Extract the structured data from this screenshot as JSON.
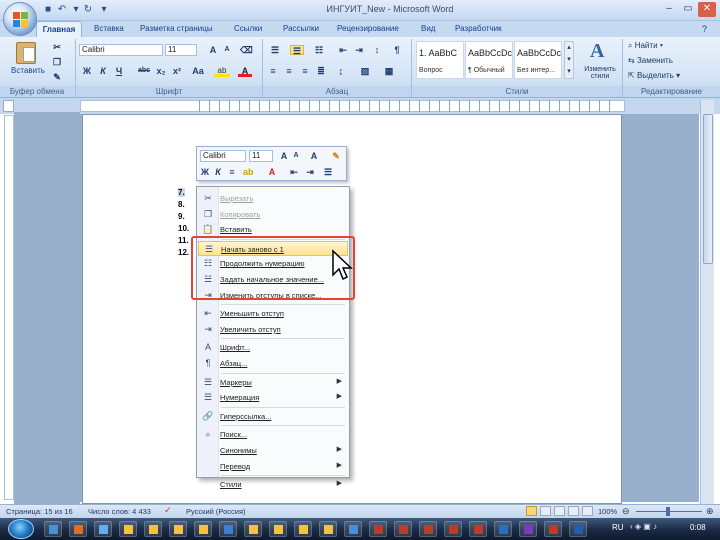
{
  "window": {
    "title": "ИНГУИТ_New - Microsoft Word"
  },
  "tabs": [
    "Главная",
    "Вставка",
    "Разметка страницы",
    "Ссылки",
    "Рассылки",
    "Рецензирование",
    "Вид",
    "Разработчик"
  ],
  "ribbon": {
    "clipboard": {
      "paste_label": "Вставить",
      "group_label": "Буфер обмена"
    },
    "font": {
      "name": "Calibri",
      "size": "11",
      "group_label": "Шрифт",
      "buttons": [
        "Ж",
        "К",
        "Ч",
        "abc",
        "x₂",
        "x²",
        "Aa"
      ]
    },
    "paragraph": {
      "group_label": "Абзац"
    },
    "styles": {
      "group_label": "Стили",
      "items": [
        {
          "preview": "1. AaBbC",
          "name": "Вопрос"
        },
        {
          "preview": "AaBbCcDc",
          "name": "¶ Обычный"
        },
        {
          "preview": "AaBbCcDc",
          "name": "Без интер..."
        }
      ],
      "change_styles": "Изменить стили"
    },
    "editing": {
      "group_label": "Редактирование",
      "find": "Найти",
      "replace": "Заменить",
      "select": "Выделить"
    }
  },
  "mini_toolbar": {
    "font": "Calibri",
    "size": "11"
  },
  "numbered_list": [
    "7.",
    "8.",
    "9.",
    "10.",
    "11.",
    "12."
  ],
  "context_menu": [
    {
      "label": "Вырезать",
      "icon": "scissors-icon",
      "disabled": true
    },
    {
      "label": "Копировать",
      "icon": "copy-icon",
      "disabled": true
    },
    {
      "label": "Вставить",
      "icon": "paste-icon",
      "disabled": false
    },
    {
      "sep": true
    },
    {
      "label": "Начать заново с 1",
      "icon": "numbering-restart-icon",
      "highlight": true
    },
    {
      "label": "Продолжить нумерацию",
      "icon": "numbering-continue-icon"
    },
    {
      "label": "Задать начальное значение...",
      "icon": "numbering-value-icon"
    },
    {
      "label": "Изменить отступы в списке...",
      "icon": "indent-list-icon"
    },
    {
      "sep": true
    },
    {
      "label": "Уменьшить отступ",
      "icon": "decrease-indent-icon"
    },
    {
      "label": "Увеличить отступ",
      "icon": "increase-indent-icon"
    },
    {
      "sep": true
    },
    {
      "label": "Шрифт...",
      "icon": "font-icon"
    },
    {
      "label": "Абзац...",
      "icon": "paragraph-icon"
    },
    {
      "sep": true
    },
    {
      "label": "Маркеры",
      "icon": "bullets-icon",
      "submenu": true
    },
    {
      "label": "Нумерация",
      "icon": "numbering-icon",
      "submenu": true
    },
    {
      "sep": true
    },
    {
      "label": "Гиперссылка...",
      "icon": "hyperlink-icon"
    },
    {
      "sep": true
    },
    {
      "label": "Поиск...",
      "icon": "search-icon"
    },
    {
      "label": "Синонимы",
      "icon": "",
      "submenu": true
    },
    {
      "label": "Перевод",
      "icon": "",
      "submenu": true
    },
    {
      "sep": true
    },
    {
      "label": "Стили",
      "icon": "",
      "submenu": true
    }
  ],
  "status": {
    "page": "Страница: 15 из 16",
    "words": "Число слов: 4 433",
    "lang": "Русский (Россия)",
    "zoom": "100%"
  },
  "tray": {
    "lang": "RU",
    "time": "0:08"
  },
  "colors": {
    "ribbon_bg": "#dbe7f6",
    "highlight": "#ffe38f",
    "annotation": "#e0462f",
    "taskbar": "#1a2a44"
  }
}
